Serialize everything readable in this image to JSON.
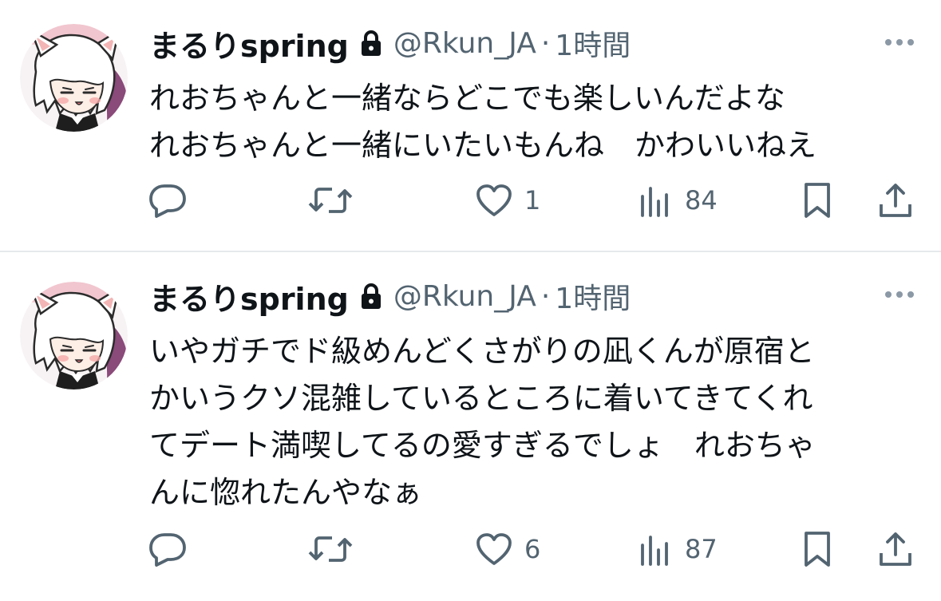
{
  "tweets": [
    {
      "author": {
        "display_name": "まるりspring",
        "handle": "@Rkun_JA",
        "protected_icon": "lock-icon",
        "avatar": "cat-eared-character-avatar"
      },
      "separator": "·",
      "time": "1時間",
      "more_icon": "more-options-icon",
      "text_lines": [
        "れおちゃんと一緒ならどこでも楽しいんだよな",
        "れおちゃんと一緒にいたいもんね　かわいいねえ"
      ],
      "actions": {
        "reply_count": "",
        "retweet_count": "",
        "like_count": "1",
        "view_count": "84"
      }
    },
    {
      "author": {
        "display_name": "まるりspring",
        "handle": "@Rkun_JA",
        "protected_icon": "lock-icon",
        "avatar": "cat-eared-character-avatar"
      },
      "separator": "·",
      "time": "1時間",
      "more_icon": "more-options-icon",
      "text_lines": [
        "いやガチでド級めんどくさがりの凪くんが原宿と",
        "かいうクソ混雑しているところに着いてきてくれ",
        "てデート満喫してるの愛すぎるでしょ　れおちゃ",
        "んに惚れたんやなぁ"
      ],
      "actions": {
        "reply_count": "",
        "retweet_count": "",
        "like_count": "6",
        "view_count": "87"
      }
    }
  ],
  "colors": {
    "text_primary": "#0f1419",
    "text_secondary": "#536471",
    "divider": "#e6e9ec",
    "icon": "#536471"
  }
}
